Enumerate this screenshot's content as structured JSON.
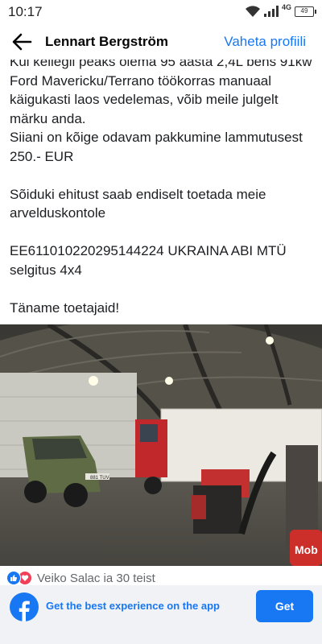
{
  "status_bar": {
    "time": "10:17",
    "network": "4G",
    "battery": "49"
  },
  "header": {
    "title": "Lennart Bergström",
    "action_link": "Vaheta profiili"
  },
  "post": {
    "paragraphs": [
      "Kui kellegil peaks olema 95 aasta 2,4L bens 91kw Ford Mavericku/Terrano töökorras manuaal käigukasti laos vedelemas, võib meile julgelt märku anda.\nSiiani on kõige odavam pakkumine lammutusest 250.- EUR",
      "Sõiduki ehitust saab endiselt toetada meie arvelduskontole",
      "EE611010220295144224 UKRAINA ABI MTÜ selgitus 4x4",
      "Täname toetajaid!"
    ],
    "photo": {
      "plate": "881 TUV",
      "sign": "Mob"
    }
  },
  "reactions": {
    "types": [
      "like",
      "love"
    ],
    "text": "Veiko Salac ia 30 teist"
  },
  "app_banner": {
    "text": "Get the best experience on the app",
    "button_label": "Get"
  },
  "colors": {
    "brand": "#1877f2",
    "love": "#f33e58",
    "banner_bg": "#f0f2f5"
  }
}
